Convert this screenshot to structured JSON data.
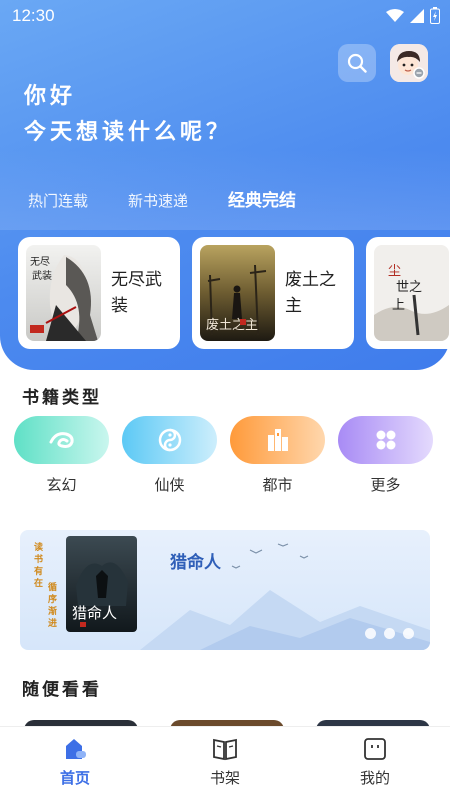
{
  "status_bar": {
    "time": "12:30"
  },
  "header": {
    "greeting_line1": "你好",
    "greeting_line2": "今天想读什么呢？",
    "tabs": [
      {
        "label": "热门连载",
        "active": false
      },
      {
        "label": "新书速递",
        "active": false
      },
      {
        "label": "经典完结",
        "active": true
      }
    ]
  },
  "featured_books": [
    {
      "title": "无尽武装",
      "cover_text": "无尽武装"
    },
    {
      "title": "废土之主",
      "cover_text": "废土之主"
    },
    {
      "title": "",
      "cover_text": "尘世之上"
    }
  ],
  "categories": {
    "title": "书籍类型",
    "items": [
      {
        "label": "玄幻",
        "icon": "dragon-icon",
        "color_from": "#5fe0c6",
        "color_to": "#c9f6ee"
      },
      {
        "label": "仙侠",
        "icon": "yin-yang-icon",
        "color_from": "#5cc9f5",
        "color_to": "#cdeefc"
      },
      {
        "label": "都市",
        "icon": "city-icon",
        "color_from": "#ff9a3a",
        "color_to": "#ffd7ad"
      },
      {
        "label": "更多",
        "icon": "clover-icon",
        "color_from": "#a88bf5",
        "color_to": "#e4dafd"
      }
    ]
  },
  "banner": {
    "book_title": "猎命人",
    "cover_text": "猎命人",
    "side_text_left": "读书有在",
    "side_text_right": "循序渐进"
  },
  "random": {
    "title": "随便看看"
  },
  "bottom_nav": [
    {
      "label": "首页",
      "icon": "home-icon",
      "active": true
    },
    {
      "label": "书架",
      "icon": "book-icon",
      "active": false
    },
    {
      "label": "我的",
      "icon": "profile-icon",
      "active": false
    }
  ],
  "colors": {
    "accent": "#3d6fe6",
    "hero": "#4d8bef"
  }
}
